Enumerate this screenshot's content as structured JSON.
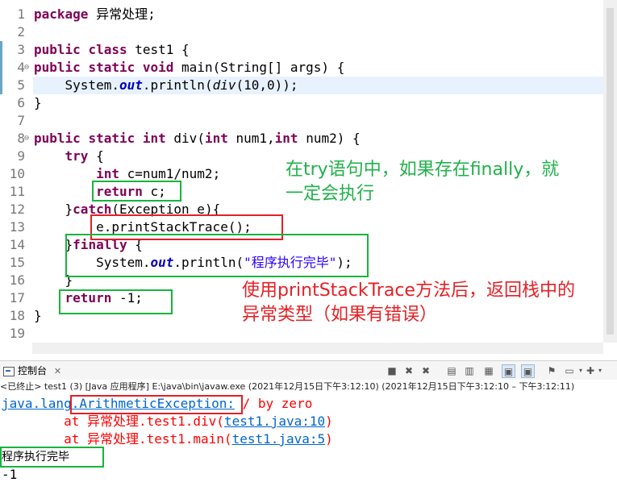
{
  "editor": {
    "lines": [
      {
        "n": "1",
        "parts": [
          [
            "kw",
            "package"
          ],
          [
            "t",
            " 异常处理;"
          ]
        ]
      },
      {
        "n": "2",
        "parts": []
      },
      {
        "n": "3",
        "parts": [
          [
            "kw",
            "public"
          ],
          [
            "t",
            " "
          ],
          [
            "kw",
            "class"
          ],
          [
            "t",
            " test1 {"
          ]
        ]
      },
      {
        "n": "4",
        "parts": [
          [
            "kw",
            "public"
          ],
          [
            "t",
            " "
          ],
          [
            "kw",
            "static"
          ],
          [
            "t",
            " "
          ],
          [
            "kw",
            "void"
          ],
          [
            "t",
            " main(String[] args) {"
          ]
        ]
      },
      {
        "n": "5",
        "parts": [
          [
            "t",
            "    System."
          ],
          [
            "fld",
            "out"
          ],
          [
            "t",
            ".println("
          ],
          [
            "it",
            "div"
          ],
          [
            "t",
            "(10,0));"
          ]
        ]
      },
      {
        "n": "6",
        "parts": [
          [
            "t",
            "}"
          ]
        ]
      },
      {
        "n": "7",
        "parts": []
      },
      {
        "n": "8",
        "parts": [
          [
            "kw",
            "public"
          ],
          [
            "t",
            " "
          ],
          [
            "kw",
            "static"
          ],
          [
            "t",
            " "
          ],
          [
            "kw",
            "int"
          ],
          [
            "t",
            " div("
          ],
          [
            "kw",
            "int"
          ],
          [
            "t",
            " num1,"
          ],
          [
            "kw",
            "int"
          ],
          [
            "t",
            " num2) {"
          ]
        ]
      },
      {
        "n": "9",
        "parts": [
          [
            "t",
            "    "
          ],
          [
            "kw",
            "try"
          ],
          [
            "t",
            " {"
          ]
        ]
      },
      {
        "n": "10",
        "parts": [
          [
            "t",
            "        "
          ],
          [
            "kw",
            "int"
          ],
          [
            "t",
            " c=num1/num2;"
          ]
        ]
      },
      {
        "n": "11",
        "parts": [
          [
            "t",
            "        "
          ],
          [
            "kw",
            "return"
          ],
          [
            "t",
            " c;"
          ]
        ]
      },
      {
        "n": "12",
        "parts": [
          [
            "t",
            "    }"
          ],
          [
            "kw",
            "catch"
          ],
          [
            "t",
            "(Exception e){"
          ]
        ]
      },
      {
        "n": "13",
        "parts": [
          [
            "t",
            "        e.printStackTrace();"
          ]
        ]
      },
      {
        "n": "14",
        "parts": [
          [
            "t",
            "    }"
          ],
          [
            "kw",
            "finally"
          ],
          [
            "t",
            " {"
          ]
        ]
      },
      {
        "n": "15",
        "parts": [
          [
            "t",
            "        System."
          ],
          [
            "fld",
            "out"
          ],
          [
            "t",
            ".println("
          ],
          [
            "str",
            "\"程序执行完毕\""
          ],
          [
            "t",
            ");"
          ]
        ]
      },
      {
        "n": "16",
        "parts": [
          [
            "t",
            "    }"
          ]
        ]
      },
      {
        "n": "17",
        "parts": [
          [
            "t",
            "    "
          ],
          [
            "kw",
            "return"
          ],
          [
            "t",
            " -1;"
          ]
        ]
      },
      {
        "n": "18",
        "parts": [
          [
            "t",
            "}"
          ]
        ]
      },
      {
        "n": "19",
        "parts": []
      }
    ]
  },
  "annotations": {
    "green_note": "在try语句中，如果存在finally，就\n一定会执行",
    "red_note": "使用printStackTrace方法后，返回栈中的\n异常类型（如果有错误）"
  },
  "console": {
    "tab_label": "控制台",
    "tab_close": "✕",
    "status": "<已终止> test1 (3)  [Java 应用程序] E:\\java\\bin\\javaw.exe  (2021年12月15日下午3:12:10)   (2021年12月15日下午3:12:10 – 下午3:12:11)",
    "line1": {
      "a": "java.lang",
      "b": ".ArithmeticException:",
      "c": " / by zero"
    },
    "line2": {
      "pre": "        at 异常处理.test1.div(",
      "link": "test1.java:10",
      "post": ")"
    },
    "line3": {
      "pre": "        at 异常处理.test1.main(",
      "link": "test1.java:5",
      "post": ")"
    },
    "line4": "程序执行完毕",
    "line5": "-1"
  },
  "colors": {
    "keyword": "#7f0055",
    "string": "#2a00ff",
    "field": "#0000c0",
    "error": "#ff0000",
    "link": "#0066cc",
    "green_note": "#21b14a",
    "red_note": "#e52025"
  }
}
